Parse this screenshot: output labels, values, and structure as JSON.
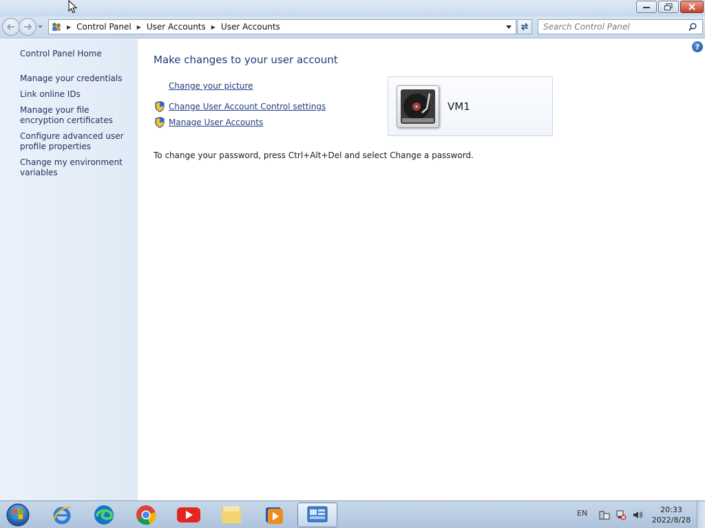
{
  "window": {
    "controls": {
      "minimize_icon": "minimize-icon",
      "restore_icon": "restore-icon",
      "close_icon": "close-icon"
    }
  },
  "navigation": {
    "breadcrumbs": [
      "Control Panel",
      "User Accounts",
      "User Accounts"
    ],
    "search_placeholder": "Search Control Panel"
  },
  "sidebar": {
    "home": "Control Panel Home",
    "items": [
      "Manage your credentials",
      "Link online IDs",
      "Manage your file encryption certificates",
      "Configure advanced user profile properties",
      "Change my environment variables"
    ]
  },
  "main": {
    "heading": "Make changes to your user account",
    "tasks": [
      {
        "label": "Change your picture",
        "shield": false
      },
      {
        "label": "Change User Account Control settings",
        "shield": true
      },
      {
        "label": "Manage User Accounts",
        "shield": true
      }
    ],
    "password_note": "To change your password, press Ctrl+Alt+Del and select Change a password.",
    "account": {
      "name": "VM1"
    },
    "help_label": "?"
  },
  "taskbar": {
    "apps": [
      "start-button",
      "internet-explorer",
      "edge",
      "chrome",
      "youtube",
      "file-explorer",
      "media-player",
      "control-panel"
    ],
    "language": "EN",
    "time": "20:33",
    "date": "2022/8/28"
  },
  "colors": {
    "link": "#1e3c82",
    "heading": "#1e3a78",
    "sidebar_bg": "#e4edf8",
    "taskbar": "#b9cbe1"
  }
}
